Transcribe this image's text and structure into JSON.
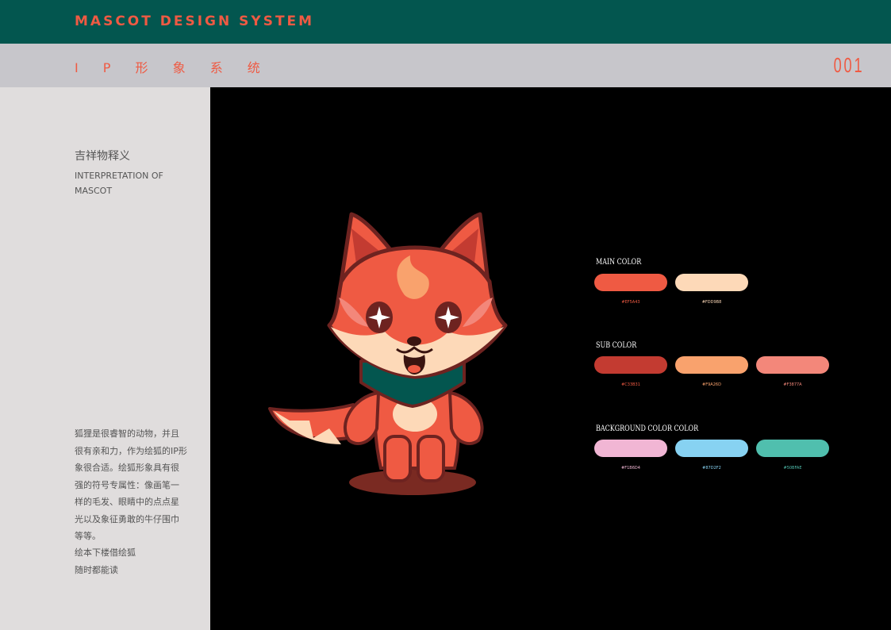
{
  "header": {
    "title": "MASCOT DESIGN SYSTEM",
    "subtitle": "I P 形 象 系 统",
    "page_number": "001"
  },
  "sidebar": {
    "heading_cn": "吉祥物释义",
    "heading_en": "INTERPRETATION OF MASCOT",
    "description": "狐狸是很睿智的动物，并且很有亲和力，作为绘狐的IP形象很合适。绘狐形象具有很强的符号专属性：像画笔一样的毛发、眼睛中的点点星光以及象征勇敢的牛仔围巾等等。",
    "slogan_line1": "绘本下楼借绘狐",
    "slogan_line2": "随时都能读"
  },
  "palette": {
    "main_label": "MAIN COLOR",
    "sub_label": "SUB COLOR",
    "bg_label": "BACKGROUND COLOR COLOR",
    "main": [
      {
        "color": "#ef5a43",
        "code": "#EF5A43"
      },
      {
        "color": "#fdd9b8",
        "code": "#FDD9B8"
      }
    ],
    "sub": [
      {
        "color": "#c33b31",
        "code": "#C33B31"
      },
      {
        "color": "#f9a26d",
        "code": "#F9A26D"
      },
      {
        "color": "#f3877a",
        "code": "#F3877A"
      }
    ],
    "bg": [
      {
        "color": "#f1b6d4",
        "code": "#F1B6D4"
      },
      {
        "color": "#87d2f2",
        "code": "#87D2F2"
      },
      {
        "color": "#50bfae",
        "code": "#50BFAE"
      }
    ]
  },
  "colors": {
    "header_bg": "#03564f",
    "subheader_bg": "#c7c6cb",
    "sidebar_bg": "#e0dddd",
    "accent": "#ef5a43"
  },
  "mascot": "fox-mascot-illustration"
}
